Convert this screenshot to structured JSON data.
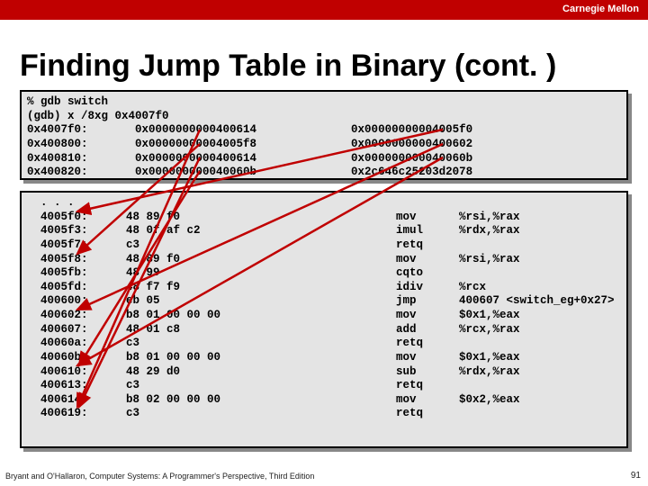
{
  "brand": "Carnegie Mellon",
  "title": "Finding Jump Table in Binary (cont. )",
  "gdb": {
    "cmd1": "% gdb switch",
    "cmd2": "(gdb) x /8xg 0x4007f0",
    "rows": [
      {
        "addr": "0x4007f0:",
        "v1": "0x0000000000400614",
        "v2": "0x00000000004005f0"
      },
      {
        "addr": "0x400800:",
        "v1": "0x00000000004005f8",
        "v2": "0x0000000000400602"
      },
      {
        "addr": "0x400810:",
        "v1": "0x0000000000400614",
        "v2": "0x000000000040060b"
      },
      {
        "addr": "0x400820:",
        "v1": "0x000000000040060b",
        "v2": "0x2c646c25203d2078"
      }
    ]
  },
  "asm": {
    "ellipsis": ". . .",
    "rows": [
      {
        "addr": "4005f0:",
        "bytes": "48 89 f0",
        "mnem": "mov",
        "ops": "%rsi,%rax"
      },
      {
        "addr": "4005f3:",
        "bytes": "48 0f af c2",
        "mnem": "imul",
        "ops": "%rdx,%rax"
      },
      {
        "addr": "4005f7:",
        "bytes": "c3",
        "mnem": "retq",
        "ops": ""
      },
      {
        "addr": "4005f8:",
        "bytes": "48 89 f0",
        "mnem": "mov",
        "ops": "%rsi,%rax"
      },
      {
        "addr": "4005fb:",
        "bytes": "48 99",
        "mnem": "cqto",
        "ops": ""
      },
      {
        "addr": "4005fd:",
        "bytes": "48 f7 f9",
        "mnem": "idiv",
        "ops": "%rcx"
      },
      {
        "addr": "400600:",
        "bytes": "eb 05",
        "mnem": "jmp",
        "ops": "400607 <switch_eg+0x27>"
      },
      {
        "addr": "400602:",
        "bytes": "b8 01 00 00 00",
        "mnem": "mov",
        "ops": "$0x1,%eax"
      },
      {
        "addr": "400607:",
        "bytes": "48 01 c8",
        "mnem": "add",
        "ops": "%rcx,%rax"
      },
      {
        "addr": "40060a:",
        "bytes": "c3",
        "mnem": "retq",
        "ops": ""
      },
      {
        "addr": "40060b:",
        "bytes": "b8 01 00 00 00",
        "mnem": "mov",
        "ops": "$0x1,%eax"
      },
      {
        "addr": "400610:",
        "bytes": "48 29 d0",
        "mnem": "sub",
        "ops": "%rdx,%rax"
      },
      {
        "addr": "400613:",
        "bytes": "c3",
        "mnem": "retq",
        "ops": ""
      },
      {
        "addr": "400614:",
        "bytes": "b8 02 00 00 00",
        "mnem": "mov",
        "ops": "$0x2,%eax"
      },
      {
        "addr": "400619:",
        "bytes": "c3",
        "mnem": "retq",
        "ops": ""
      }
    ]
  },
  "footer": "Bryant and O'Hallaron, Computer Systems: A Programmer's Perspective, Third Edition",
  "pagenum": "91"
}
